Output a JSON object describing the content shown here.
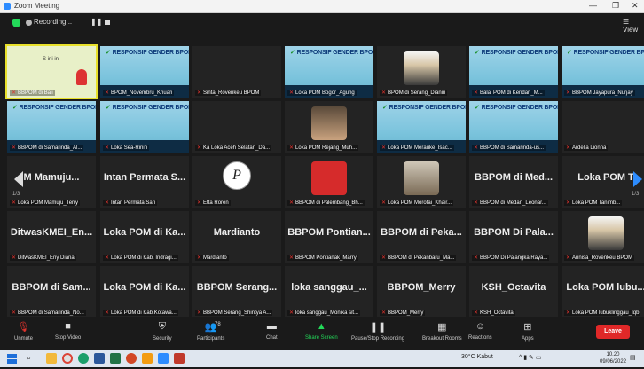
{
  "window": {
    "title": "Zoom Meeting"
  },
  "topbar": {
    "recording": "Recording...",
    "view_label": "View"
  },
  "slide_banner": "RESPONSIF GENDER BPOM",
  "slide_small": "S ini ini",
  "page_indicator_left": "1/3",
  "page_indicator_right": "1/3",
  "tiles": [
    {
      "name": "BBPOM di Bali",
      "kind": "slide"
    },
    {
      "name": "BPOM_Novembru_Khuari",
      "kind": "slide"
    },
    {
      "name": "Sinta_Rovenkeu BPOM",
      "kind": "dark"
    },
    {
      "name": "Loka POM Bogor_Agung",
      "kind": "slide"
    },
    {
      "name": "BPOM di Serang_Dianin",
      "kind": "photo"
    },
    {
      "name": "Balai POM di Kendari_M...",
      "kind": "slide"
    },
    {
      "name": "BBPOM Jayapura_Nurjay",
      "kind": "slide"
    },
    {
      "name": "BBPOM di Samarinda_Al...",
      "kind": "slide"
    },
    {
      "name": "Loka Sea-Rinin",
      "kind": "slide"
    },
    {
      "name": "Ka Loka Aceh Selatan_Da...",
      "kind": "dark"
    },
    {
      "name": "Loka POM Rejang_Muh...",
      "kind": "photo"
    },
    {
      "name": "Loka POM Merauke_Isac...",
      "kind": "slide"
    },
    {
      "name": "BBPOM di Samarinda-us...",
      "kind": "slide"
    },
    {
      "name": "Ardelia Lionna",
      "kind": "dark"
    },
    {
      "name": "Loka POM Mamuju_Terry",
      "big": "M Mamuju...",
      "kind": "name"
    },
    {
      "name": "Intan Permata Sari",
      "big": "Intan Permata S...",
      "kind": "name"
    },
    {
      "name": "Etta Roren",
      "kind": "logo",
      "logo": "P"
    },
    {
      "name": "BBPOM di Palembang_Bh...",
      "kind": "photo"
    },
    {
      "name": "Loka POM Morotai_Khair...",
      "kind": "photo"
    },
    {
      "name": "BBPOM di Medan_Leonar...",
      "big": "BBPOM di Med...",
      "kind": "name"
    },
    {
      "name": "Loka POM Tanimb...",
      "big": "Loka POM T",
      "kind": "name"
    },
    {
      "name": "DitwasKMEI_Eny Diana",
      "big": "DitwasKMEI_En...",
      "kind": "name"
    },
    {
      "name": "Loka POM di Kab. Indragi...",
      "big": "Loka POM di Ka...",
      "kind": "name"
    },
    {
      "name": "Mardianto",
      "big": "Mardianto",
      "kind": "name"
    },
    {
      "name": "BBPOM Pontianak_Marry",
      "big": "BBPOM Pontian...",
      "kind": "name"
    },
    {
      "name": "BBPOM di Pekanbaru_Ma...",
      "big": "BBPOM di Peka...",
      "kind": "name"
    },
    {
      "name": "BBPOM Di Palangka Raya...",
      "big": "BBPOM Di Pala...",
      "kind": "name"
    },
    {
      "name": "Annisa_Rovenkeu BPOM",
      "kind": "photo"
    },
    {
      "name": "BBPOM di Samarinda_No...",
      "big": "BBPOM di Sam...",
      "kind": "name"
    },
    {
      "name": "Loka POM di Kab.Kotawa...",
      "big": "Loka POM di Ka...",
      "kind": "name"
    },
    {
      "name": "BBPOM Serang_Shintya A...",
      "big": "BBPOM Serang...",
      "kind": "name"
    },
    {
      "name": "loka sanggau_Monika sit...",
      "big": "loka sanggau_...",
      "kind": "name"
    },
    {
      "name": "BBPOM_Merry",
      "big": "BBPOM_Merry",
      "kind": "name"
    },
    {
      "name": "KSH_Octavita",
      "big": "KSH_Octavita",
      "kind": "name"
    },
    {
      "name": "Loka POM lubuklinggau_Iqb",
      "big": "Loka POM lubu...",
      "kind": "name"
    }
  ],
  "toolbar": [
    {
      "label": "Unmute",
      "icon": "mic-off-icon"
    },
    {
      "label": "Stop Video",
      "icon": "video-icon"
    },
    {
      "label": "Security",
      "icon": "shield-icon"
    },
    {
      "label": "Participants",
      "icon": "participants-icon",
      "count": "78"
    },
    {
      "label": "Chat",
      "icon": "chat-icon"
    },
    {
      "label": "Share Screen",
      "icon": "share-screen-icon"
    },
    {
      "label": "Pause/Stop Recording",
      "icon": "pause-icon"
    },
    {
      "label": "Breakout Rooms",
      "icon": "breakout-icon"
    },
    {
      "label": "Reactions",
      "icon": "reactions-icon"
    },
    {
      "label": "Apps",
      "icon": "apps-icon"
    }
  ],
  "leave_label": "Leave",
  "taskbar": {
    "weather": "30°C Kabut",
    "time": "10.20",
    "date": "09/06/2022"
  },
  "colors": {
    "accent_green": "#23d959",
    "leave_red": "#e02828",
    "mic_red": "#e0332d"
  }
}
